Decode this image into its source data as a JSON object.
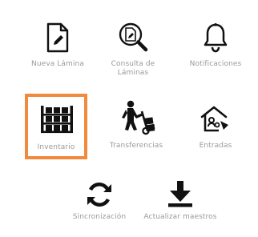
{
  "menu": {
    "items": [
      {
        "label": "Nueva Lámina",
        "icon": "new-sheet-icon",
        "selected": false
      },
      {
        "label": "Consulta de\nLáminas",
        "icon": "search-document-icon",
        "selected": false
      },
      {
        "label": "Notificaciones",
        "icon": "bell-icon",
        "selected": false
      },
      {
        "label": "Inventario",
        "icon": "warehouse-shelves-icon",
        "selected": true
      },
      {
        "label": "Transferencias",
        "icon": "hand-truck-icon",
        "selected": false
      },
      {
        "label": "Entradas",
        "icon": "house-entry-icon",
        "selected": false
      },
      {
        "label": "Sincronización",
        "icon": "sync-icon",
        "selected": false
      },
      {
        "label": "Actualizar maestros",
        "icon": "download-icon",
        "selected": false
      }
    ]
  },
  "colors": {
    "icon": "#111111",
    "label": "#9a9a9a",
    "selected_border": "#f08a3c"
  }
}
